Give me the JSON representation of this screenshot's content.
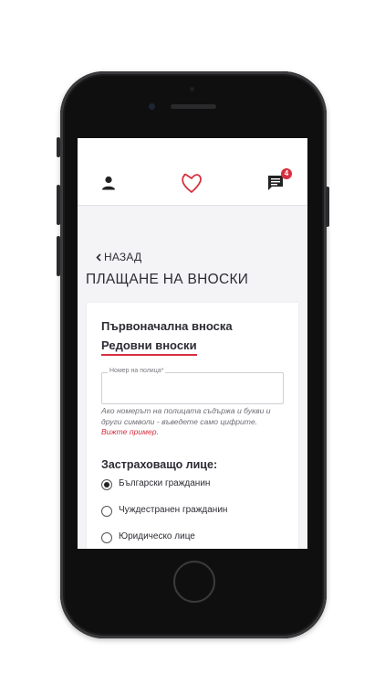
{
  "header": {
    "notification_count": "4",
    "accent_color": "#d6303f",
    "icons": [
      "user-icon",
      "heart-logo",
      "chat-icon"
    ]
  },
  "nav": {
    "back_label": "НАЗАД"
  },
  "page": {
    "title": "ПЛАЩАНЕ НА ВНОСКИ"
  },
  "tabs": {
    "first": "Първоначална вноска",
    "second": "Редовни вноски",
    "active": "Редовни вноски"
  },
  "policy_field": {
    "label": "Номер на полица*",
    "value": "",
    "help_text": "Ако номерът на полицата съдържа и букви и други символи - въведете само цифрите.",
    "example_link": "Вижте пример."
  },
  "insured": {
    "label": "Застраховащо лице:",
    "options": [
      {
        "label": "Български гражданин",
        "checked": true
      },
      {
        "label": "Чуждестранен гражданин",
        "checked": false
      },
      {
        "label": "Юридическо лице",
        "checked": false
      }
    ]
  }
}
